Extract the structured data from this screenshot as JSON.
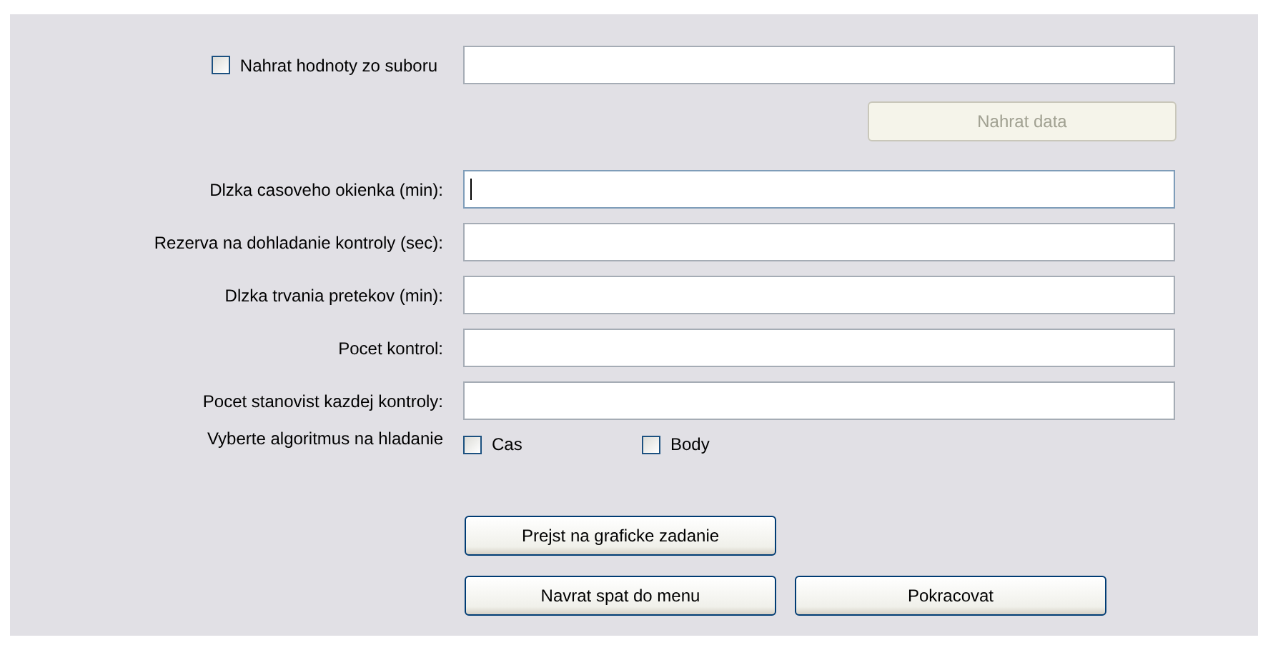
{
  "load_from_file": {
    "label": "Nahrat hodnoty zo suboru",
    "checked": false
  },
  "load_button": {
    "label": "Nahrat data",
    "disabled": true
  },
  "fields": [
    {
      "label": "Dlzka casoveho okienka (min):",
      "focused": true
    },
    {
      "label": "Rezerva na dohladanie kontroly (sec):",
      "focused": false
    },
    {
      "label": "Dlzka trvania pretekov (min):",
      "focused": false
    },
    {
      "label": "Pocet kontrol:",
      "focused": false
    },
    {
      "label": "Pocet stanovist kazdej kontroly:",
      "focused": false
    }
  ],
  "algorithm": {
    "label": "Vyberte algoritmus na hladanie",
    "options": [
      {
        "label": "Cas",
        "checked": false
      },
      {
        "label": "Body",
        "checked": false
      }
    ]
  },
  "button_rows": [
    [
      {
        "label": "Prejst na graficke zadanie"
      }
    ],
    [
      {
        "label": "Navrat spat do menu"
      },
      {
        "label": "Pokracovat"
      }
    ]
  ]
}
